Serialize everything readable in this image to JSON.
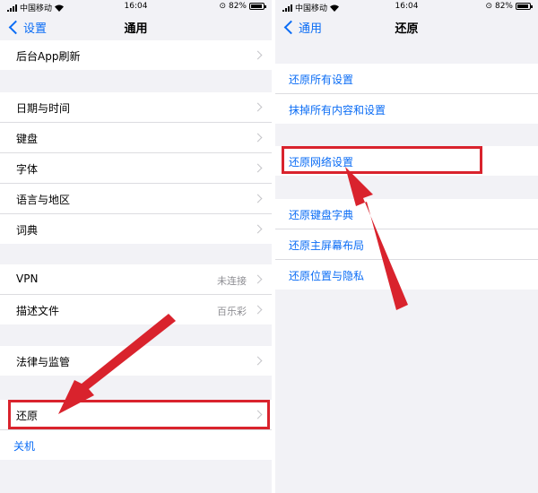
{
  "status_left": {
    "carrier": "中国移动",
    "time": "16:04",
    "battery": "82%",
    "battery_level": 0.82
  },
  "status_right": {
    "carrier": "中国移动",
    "time": "16:04",
    "battery": "82%",
    "battery_level": 0.82
  },
  "left_screen": {
    "back_label": "设置",
    "title": "通用",
    "groups": [
      [
        {
          "label": "后台App刷新"
        }
      ],
      [
        {
          "label": "日期与时间"
        },
        {
          "label": "键盘"
        },
        {
          "label": "字体"
        },
        {
          "label": "语言与地区"
        },
        {
          "label": "词典"
        }
      ],
      [
        {
          "label": "VPN",
          "value": "未连接"
        },
        {
          "label": "描述文件",
          "value": "百乐彩"
        }
      ],
      [
        {
          "label": "法律与监管"
        }
      ],
      [
        {
          "label": "还原"
        },
        {
          "label": "关机"
        }
      ]
    ]
  },
  "right_screen": {
    "back_label": "通用",
    "title": "还原",
    "groups": [
      [
        {
          "label": "还原所有设置"
        },
        {
          "label": "抹掉所有内容和设置"
        }
      ],
      [
        {
          "label": "还原网络设置"
        }
      ],
      [
        {
          "label": "还原键盘字典"
        },
        {
          "label": "还原主屏幕布局"
        },
        {
          "label": "还原位置与隐私"
        }
      ]
    ]
  },
  "annotation_color": "#d9232d",
  "link_color": "#0a6cf5"
}
